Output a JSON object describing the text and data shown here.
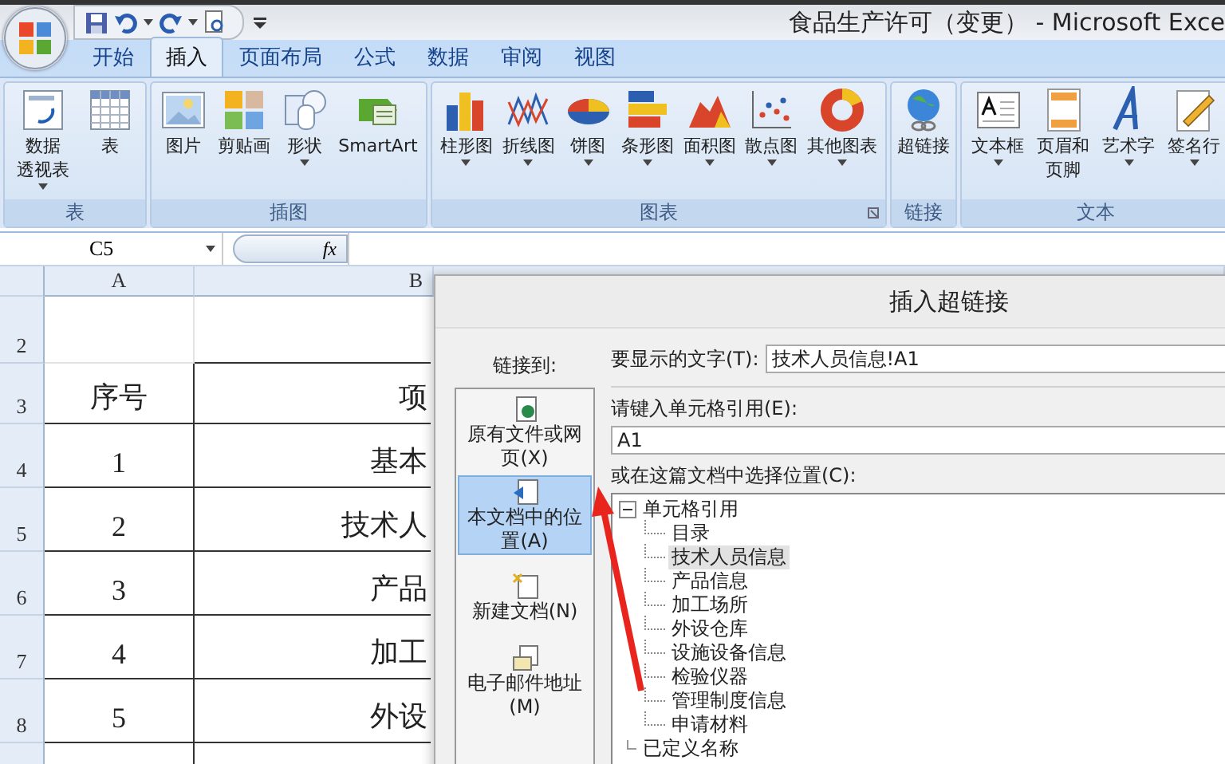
{
  "window": {
    "title": "食品生产许可（变更） - Microsoft Exce"
  },
  "tabs": [
    {
      "label": "开始",
      "selected": false
    },
    {
      "label": "插入",
      "selected": true
    },
    {
      "label": "页面布局",
      "selected": false
    },
    {
      "label": "公式",
      "selected": false
    },
    {
      "label": "数据",
      "selected": false
    },
    {
      "label": "审阅",
      "selected": false
    },
    {
      "label": "视图",
      "selected": false
    }
  ],
  "ribbon_groups": [
    {
      "label": "表",
      "launcher": false,
      "buttons": [
        {
          "lines": [
            "数据",
            "透视表"
          ],
          "dropdown": true
        },
        {
          "lines": [
            "表"
          ],
          "dropdown": false
        }
      ]
    },
    {
      "label": "插图",
      "launcher": false,
      "buttons": [
        {
          "lines": [
            "图片"
          ],
          "dropdown": false
        },
        {
          "lines": [
            "剪贴画"
          ],
          "dropdown": false
        },
        {
          "lines": [
            "形状"
          ],
          "dropdown": true
        },
        {
          "lines": [
            "SmartArt"
          ],
          "dropdown": false
        }
      ]
    },
    {
      "label": "图表",
      "launcher": true,
      "buttons": [
        {
          "lines": [
            "柱形图"
          ],
          "dropdown": true
        },
        {
          "lines": [
            "折线图"
          ],
          "dropdown": true
        },
        {
          "lines": [
            "饼图"
          ],
          "dropdown": true
        },
        {
          "lines": [
            "条形图"
          ],
          "dropdown": true
        },
        {
          "lines": [
            "面积图"
          ],
          "dropdown": true
        },
        {
          "lines": [
            "散点图"
          ],
          "dropdown": true
        },
        {
          "lines": [
            "其他图表"
          ],
          "dropdown": true
        }
      ]
    },
    {
      "label": "链接",
      "launcher": false,
      "buttons": [
        {
          "lines": [
            "超链接"
          ],
          "dropdown": false
        }
      ]
    },
    {
      "label": "文本",
      "launcher": false,
      "buttons": [
        {
          "lines": [
            "文本框"
          ],
          "dropdown": true
        },
        {
          "lines": [
            "页眉和",
            "页脚"
          ],
          "dropdown": false
        },
        {
          "lines": [
            "艺术字"
          ],
          "dropdown": true
        },
        {
          "lines": [
            "签名行"
          ],
          "dropdown": true
        }
      ]
    }
  ],
  "formula_bar": {
    "name_box": "C5",
    "fx": "fx"
  },
  "sheet": {
    "columns": [
      "A",
      "B"
    ],
    "rows": [
      {
        "number": "2"
      },
      {
        "number": "3",
        "a": "序号",
        "b": "项"
      },
      {
        "number": "4",
        "a": "1",
        "b": "基本"
      },
      {
        "number": "5",
        "a": "2",
        "b": "技术人"
      },
      {
        "number": "6",
        "a": "3",
        "b": "产品"
      },
      {
        "number": "7",
        "a": "4",
        "b": "加工"
      },
      {
        "number": "8",
        "a": "5",
        "b": "外设"
      }
    ]
  },
  "dialog": {
    "title": "插入超链接",
    "link_to_label": "链接到:",
    "link_targets": [
      {
        "label": "原有文件或网页(X)",
        "selected": false
      },
      {
        "label": "本文档中的位置(A)",
        "selected": true
      },
      {
        "label": "新建文档(N)",
        "selected": false
      },
      {
        "label": "电子邮件地址(M)",
        "selected": false
      }
    ],
    "display_text": {
      "label": "要显示的文字(T):",
      "value": "技术人员信息!A1"
    },
    "cell_ref": {
      "label": "请键入单元格引用(E):",
      "value": "A1"
    },
    "location": {
      "label": "或在这篇文档中选择位置(C):",
      "tree": [
        {
          "label": "单元格引用",
          "expanded": true,
          "children": [
            {
              "label": "目录",
              "selected": false
            },
            {
              "label": "技术人员信息",
              "selected": true
            },
            {
              "label": "产品信息",
              "selected": false
            },
            {
              "label": "加工场所",
              "selected": false
            },
            {
              "label": "外设仓库",
              "selected": false
            },
            {
              "label": "设施设备信息",
              "selected": false
            },
            {
              "label": "检验仪器",
              "selected": false
            },
            {
              "label": "管理制度信息",
              "selected": false
            },
            {
              "label": "申请材料",
              "selected": false
            }
          ]
        },
        {
          "label": "已定义名称"
        }
      ]
    }
  }
}
